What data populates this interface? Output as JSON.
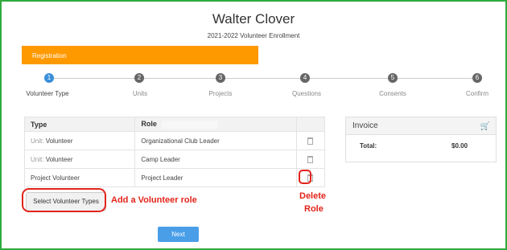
{
  "header": {
    "title": "Walter Clover",
    "subtitle": "2021-2022 Volunteer Enrollment"
  },
  "progress": {
    "label": "Registration"
  },
  "steps": [
    {
      "number": "1",
      "label": "Volunteer Type"
    },
    {
      "number": "2",
      "label": "Units"
    },
    {
      "number": "3",
      "label": "Projects"
    },
    {
      "number": "4",
      "label": "Questions"
    },
    {
      "number": "5",
      "label": "Consents"
    },
    {
      "number": "6",
      "label": "Confirm"
    }
  ],
  "table": {
    "headers": {
      "type": "Type",
      "role": "Role"
    },
    "rows": [
      {
        "type_prefix": "Unit:",
        "type": "Volunteer",
        "role": "Organizational Club Leader"
      },
      {
        "type_prefix": "Unit:",
        "type": "Volunteer",
        "role": "Camp Leader"
      },
      {
        "type_prefix": "",
        "type": "Project Volunteer",
        "role": "Project Leader"
      }
    ]
  },
  "invoice": {
    "title": "Invoice",
    "total_label": "Total:",
    "total_value": "$0.00",
    "cart_icon": "cart-icon"
  },
  "buttons": {
    "select_types": "Select Volunteer Types",
    "next": "Next"
  },
  "annotations": {
    "add_role": "Add a Volunteer role",
    "delete_role_line1": "Delete",
    "delete_role_line2": "Role",
    "color": "#e2231a"
  },
  "colors": {
    "accent_orange": "#ff9900",
    "active_step": "#3a8fd9",
    "next_button": "#4a9ee8",
    "frame": "#2eaa3c"
  }
}
